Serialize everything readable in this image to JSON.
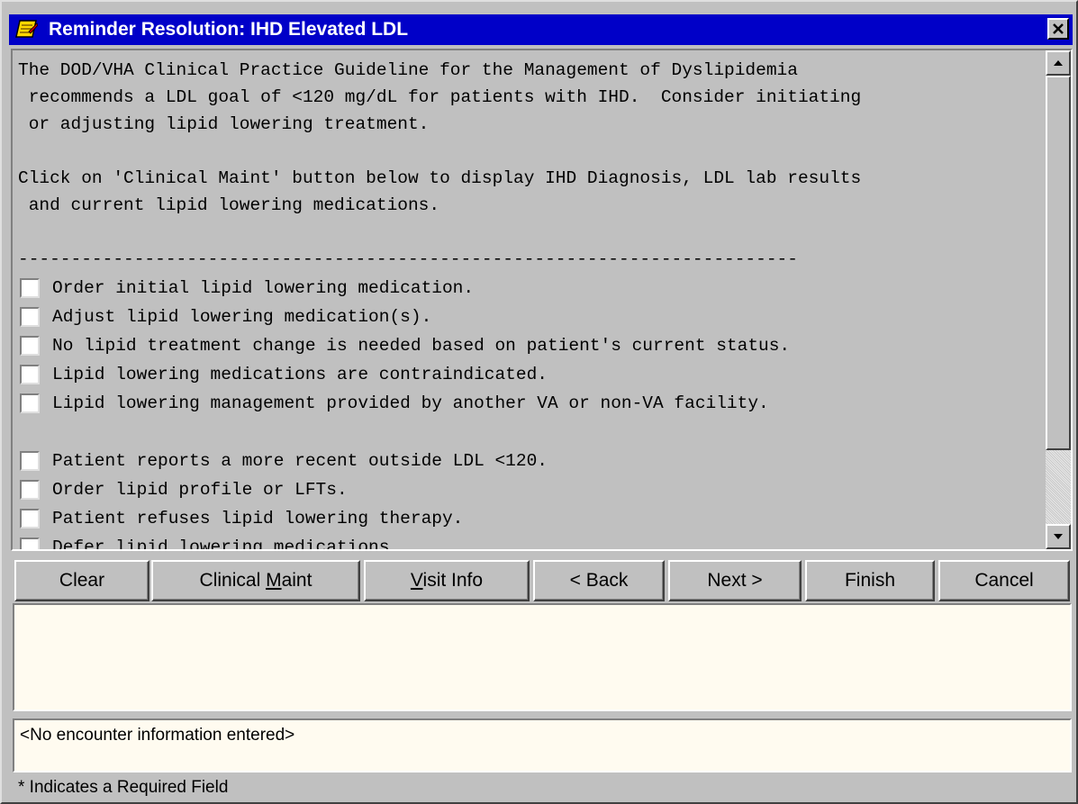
{
  "window": {
    "title": "Reminder Resolution: IHD Elevated LDL",
    "icon": "reminder-notebook-icon",
    "close_icon": "close-icon"
  },
  "content": {
    "lines": [
      "The DOD/VHA Clinical Practice Guideline for the Management of Dyslipidemia",
      " recommends a LDL goal of <120 mg/dL for patients with IHD.  Consider initiating",
      " or adjusting lipid lowering treatment.",
      "Click on 'Clinical Maint' button below to display IHD Diagnosis, LDL lab results",
      " and current lipid lowering medications.",
      "--------------------------------------------------------------------------"
    ],
    "options": [
      {
        "label": "Order initial lipid lowering medication.",
        "checked": false
      },
      {
        "label": "Adjust lipid lowering medication(s).",
        "checked": false
      },
      {
        "label": "No lipid treatment change is needed based on patient's current status.",
        "checked": false
      },
      {
        "label": "Lipid lowering medications are contraindicated.",
        "checked": false
      },
      {
        "label": "Lipid lowering management provided by another VA or non-VA facility.",
        "checked": false
      },
      {
        "label": "Patient reports a more recent outside LDL <120.",
        "checked": false
      },
      {
        "label": "Order lipid profile or LFTs.",
        "checked": false
      },
      {
        "label": "Patient refuses lipid lowering therapy.",
        "checked": false
      },
      {
        "label": "Defer lipid lowering medications",
        "checked": false
      }
    ]
  },
  "buttons": {
    "clear": "Clear",
    "clinical_maint_pre": "Clinical ",
    "clinical_maint_ul": "M",
    "clinical_maint_post": "aint",
    "visit_info_ul": "V",
    "visit_info_post": "isit Info",
    "back": "< Back",
    "next": "Next >",
    "finish": "Finish",
    "cancel": "Cancel"
  },
  "progress_note": "",
  "encounter": {
    "text": "<No encounter information entered>"
  },
  "status_bar": {
    "text": "* Indicates a Required Field"
  },
  "colors": {
    "title_bar": "#0000c8",
    "window_face": "#c0c0c0",
    "note_background": "#fffbf0"
  }
}
